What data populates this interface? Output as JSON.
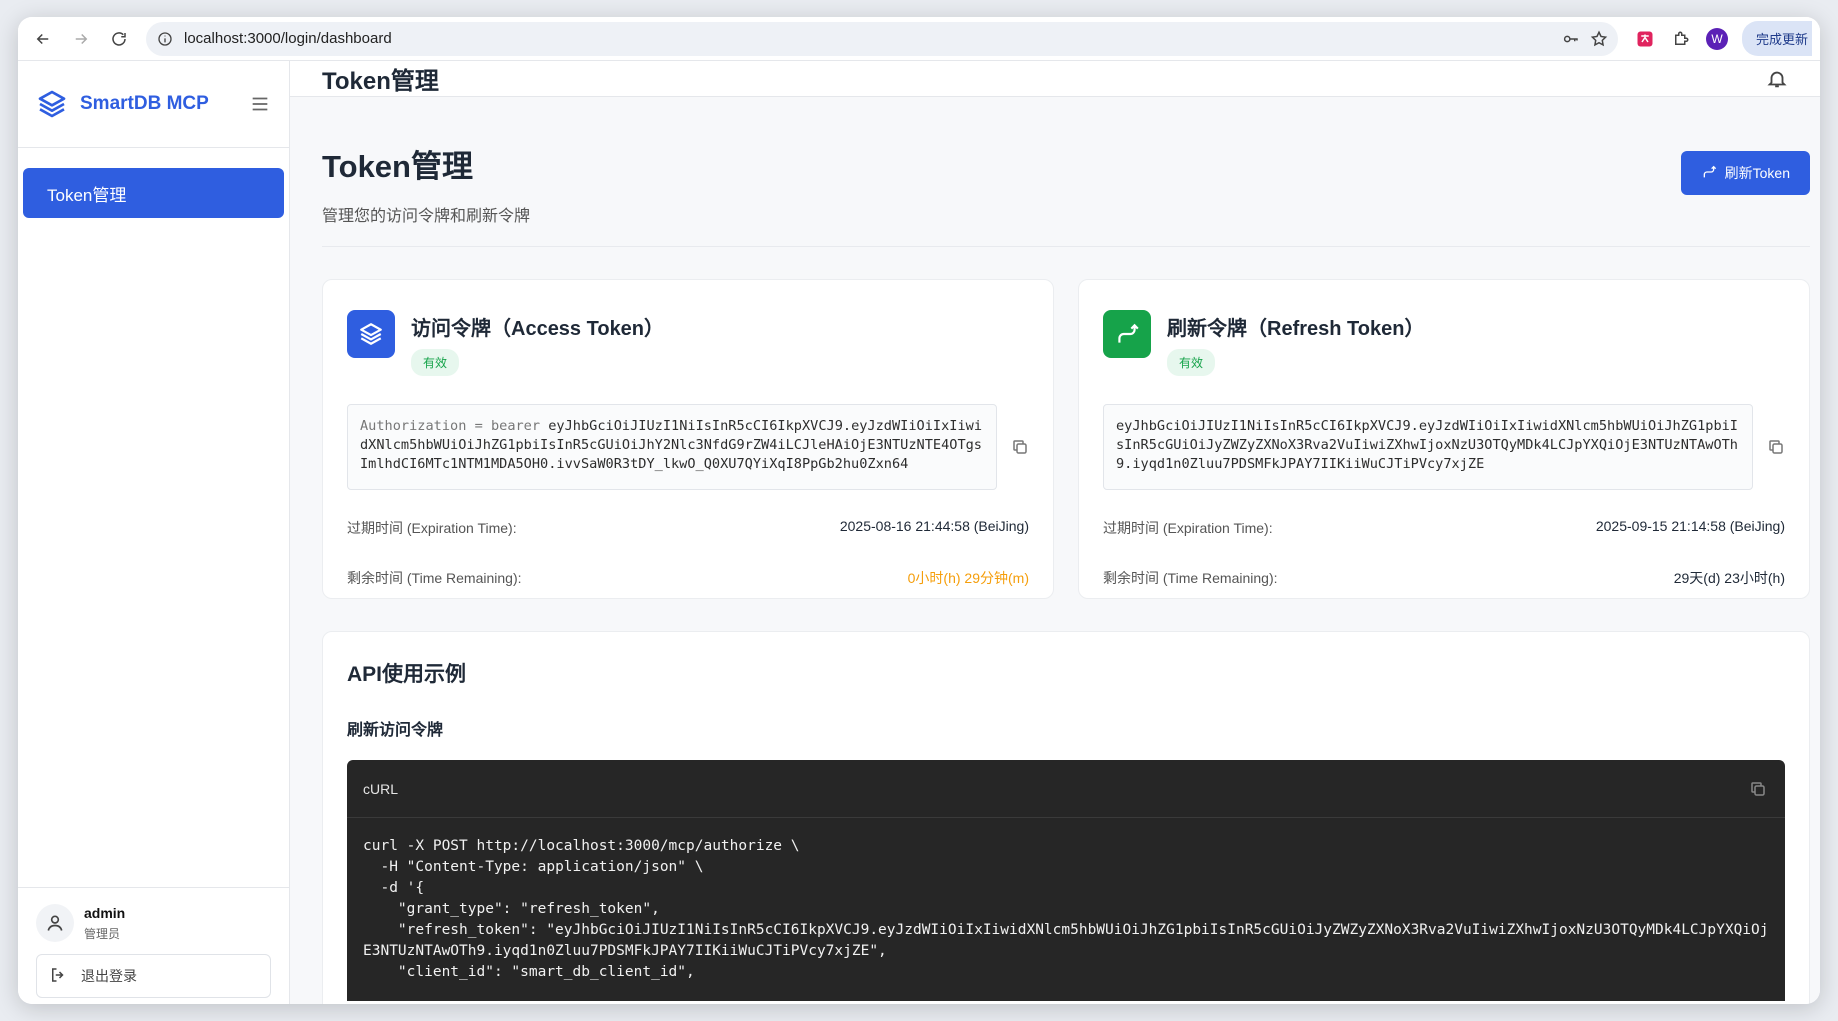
{
  "browser": {
    "url": "localhost:3000/login/dashboard",
    "profile_initial": "W",
    "update_label": "完成更新"
  },
  "sidebar": {
    "brand": "SmartDB MCP",
    "items": [
      {
        "label": "Token管理"
      }
    ],
    "user": {
      "name": "admin",
      "role": "管理员"
    },
    "logout_label": "退出登录"
  },
  "topbar": {
    "title": "Token管理"
  },
  "page": {
    "title": "Token管理",
    "subtitle": "管理您的访问令牌和刷新令牌",
    "refresh_label": "刷新Token"
  },
  "access_token": {
    "title": "访问令牌（Access Token）",
    "status": "有效",
    "prefix": "Authorization = bearer ",
    "token": "eyJhbGciOiJIUzI1NiIsInR5cCI6IkpXVCJ9.eyJzdWIiOiIxIiwidXNlcm5hbWUiOiJhZG1pbiIsInR5cGUiOiJhY2Nlc3NfdG9rZW4iLCJleHAiOjE3NTUzNTE4OTgsImlhdCI6MTc1NTM1MDA5OH0.ivvSaW0R3tDY_lkwO_Q0XU7QYiXqI8PpGb2hu0Zxn64",
    "expiration_label": "过期时间 (Expiration Time):",
    "expiration_value": "2025-08-16 21:44:58 (BeiJing)",
    "remaining_label": "剩余时间 (Time Remaining):",
    "remaining_value": "0小时(h) 29分钟(m)",
    "accent": "#2f5ee0"
  },
  "refresh_token": {
    "title": "刷新令牌（Refresh Token）",
    "status": "有效",
    "token": "eyJhbGciOiJIUzI1NiIsInR5cCI6IkpXVCJ9.eyJzdWIiOiIxIiwidXNlcm5hbWUiOiJhZG1pbiIsInR5cGUiOiJyZWZyZXNoX3Rva2VuIiwiZXhwIjoxNzU3OTQyMDk4LCJpYXQiOjE3NTUzNTAwOTh9.iyqd1n0Zluu7PDSMFkJPAY7IIKiiWuCJTiPVcy7xjZE",
    "expiration_label": "过期时间 (Expiration Time):",
    "expiration_value": "2025-09-15 21:14:58 (BeiJing)",
    "remaining_label": "剩余时间 (Time Remaining):",
    "remaining_value": "29天(d) 23小时(h)",
    "accent": "#16a34a"
  },
  "api": {
    "title": "API使用示例",
    "subtitle": "刷新访问令牌",
    "lang_label": "cURL",
    "code": "curl -X POST http://localhost:3000/mcp/authorize \\\n  -H \"Content-Type: application/json\" \\\n  -d '{\n    \"grant_type\": \"refresh_token\",\n    \"refresh_token\": \"eyJhbGciOiJIUzI1NiIsInR5cCI6IkpXVCJ9.eyJzdWIiOiIxIiwidXNlcm5hbWUiOiJhZG1pbiIsInR5cGUiOiJyZWZyZXNoX3Rva2VuIiwiZXhwIjoxNzU3OTQyMDk4LCJpYXQiOjE3NTUzNTAwOTh9.iyqd1n0Zluu7PDSMFkJPAY7IIKiiWuCJTiPVcy7xjZE\",\n    \"client_id\": \"smart_db_client_id\","
  }
}
